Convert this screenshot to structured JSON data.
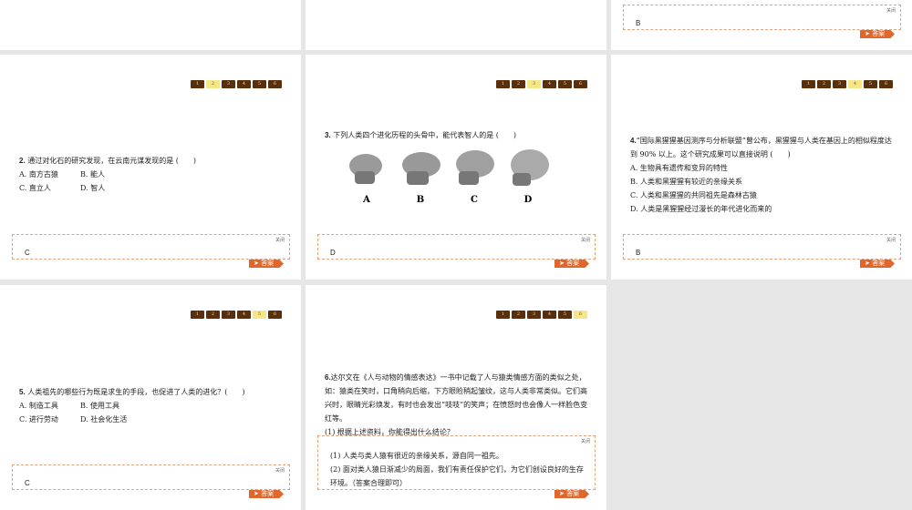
{
  "nav": [
    "1",
    "2",
    "3",
    "4",
    "5",
    "6"
  ],
  "close_label": "关闭",
  "answer_button": "答案",
  "slides": {
    "s1": {
      "answer": "B"
    },
    "q2": {
      "num": "2.",
      "text": "通过对化石的研究发现，在云南元谋发现的是 (　　)",
      "options": [
        "A. 南方古猿",
        "B. 能人",
        "C. 直立人",
        "D. 智人"
      ],
      "answer": "C"
    },
    "q3": {
      "num": "3.",
      "text": "下列人类四个进化历程的头骨中，能代表智人的是 (　　)",
      "labels": [
        "A",
        "B",
        "C",
        "D"
      ],
      "answer": "D"
    },
    "q4": {
      "num": "4.",
      "text": "“国际黑猩猩基因测序与分析联盟”曾公布，黑猩猩与人类在基因上的相似程度达到 90% 以上。这个研究成果可以直接说明 (　　)",
      "options": [
        "A. 生物具有遗传和变异的特性",
        "B. 人类和黑猩猩有较近的亲缘关系",
        "C. 人类和黑猩猩的共同祖先是森林古猿",
        "D. 人类是黑猩猩经过漫长的年代进化而来的"
      ],
      "answer": "B"
    },
    "q5": {
      "num": "5.",
      "text": "人类祖先的哪些行为既是求生的手段，也促进了人类的进化？(　　)",
      "options": [
        "A. 制造工具",
        "B. 使用工具",
        "C. 进行劳动",
        "D. 社会化生活"
      ],
      "answer": "C"
    },
    "q6": {
      "num": "6.",
      "text": "达尔文在《人与动物的情感表达》一书中记载了人与猿类情感方面的类似之处，如：猿类在笑时，口角稍向后缩，下方眼睑稍起皱纹，这与人类非常类似。它们高兴时，眼睛光彩焕发，有时也会发出“吱吱”的笑声；在愤怒时也会像人一样脸色变红等。",
      "sub": "(1) 根据上述资料，你能得出什么结论？",
      "answers": [
        "(1) 人类与类人猿有很近的亲缘关系，源自同一祖先。",
        "(2) 面对类人猿日渐减少的局面，我们有责任保护它们，为它们创设良好的生存环境。（答案合理即可）"
      ]
    }
  }
}
